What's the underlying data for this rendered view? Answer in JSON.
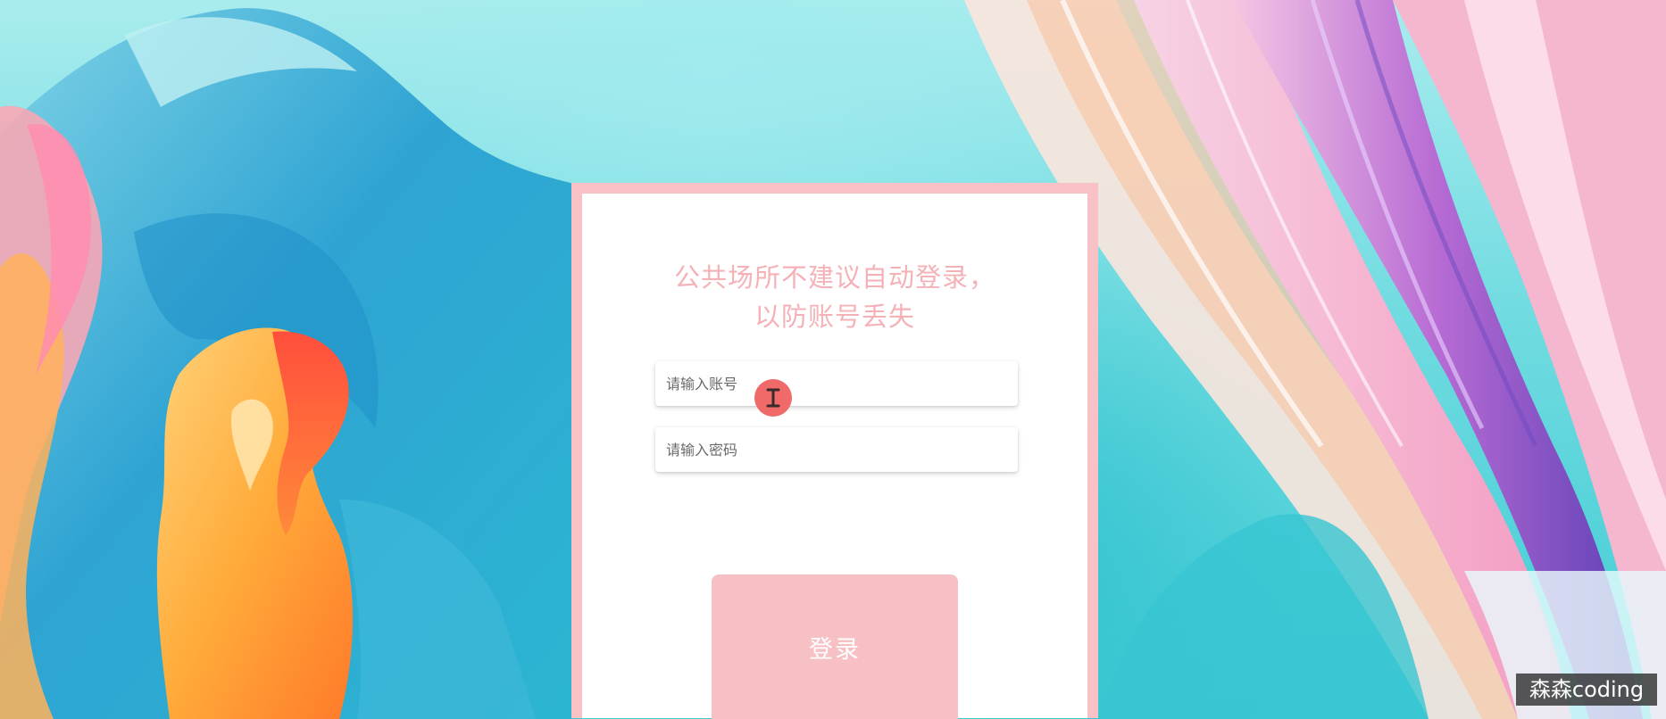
{
  "login": {
    "notice_line1": "公共场所不建议自动登录，",
    "notice_line2": "以防账号丢失",
    "account_placeholder": "请输入账号",
    "password_placeholder": "请输入密码",
    "submit_label": "登录"
  },
  "watermark": {
    "text": "森森coding"
  },
  "cursor": {
    "icon": "text-cursor-icon"
  },
  "colors": {
    "card_border": "#f7c1c5",
    "notice_text": "#f4b2b7",
    "button_bg": "#f7c0c4",
    "cursor_dot": "#f06a6a"
  }
}
